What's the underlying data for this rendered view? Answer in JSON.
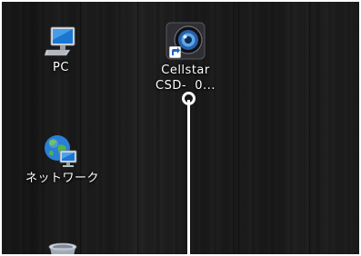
{
  "desktop": {
    "icons": [
      {
        "label": "PC",
        "icon": "pc-monitor-icon"
      },
      {
        "label_line1": "Cellstar",
        "label_line2": "CSD-  0...",
        "icon": "cellstar-camera-shortcut-icon"
      },
      {
        "label": "ネットワーク",
        "icon": "network-globe-icon"
      },
      {
        "label": "",
        "icon": "recycle-bin-icon"
      }
    ]
  },
  "annotation": {
    "callout_color": "#ffffff",
    "shape": "pin-line"
  }
}
